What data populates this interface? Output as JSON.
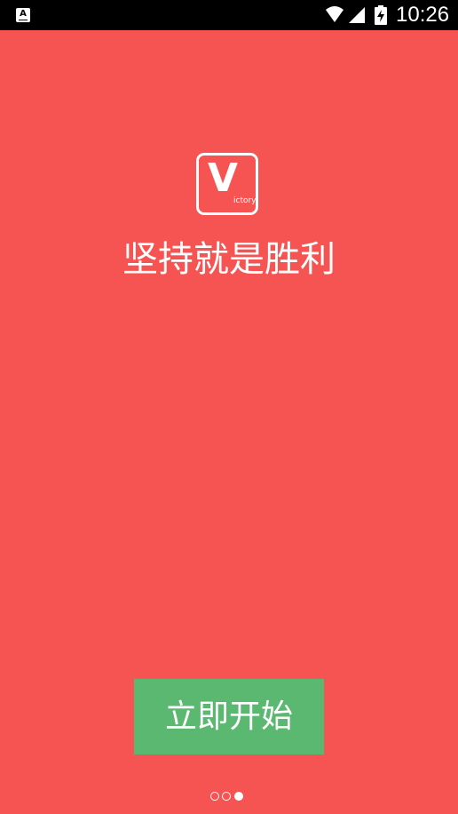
{
  "status_bar": {
    "app_icon_glyph": "A",
    "time": "10:26",
    "icons": [
      "wifi-icon",
      "cell-signal-icon",
      "battery-charging-icon"
    ]
  },
  "splash": {
    "logo_letter": "V",
    "logo_text": "ictory",
    "slogan": "坚持就是胜利",
    "start_button_label": "立即开始"
  },
  "pager": {
    "total": 3,
    "active_index": 2
  },
  "colors": {
    "background": "#f65453",
    "button": "#5bb870",
    "status_bar": "#000000",
    "foreground": "#ffffff"
  }
}
